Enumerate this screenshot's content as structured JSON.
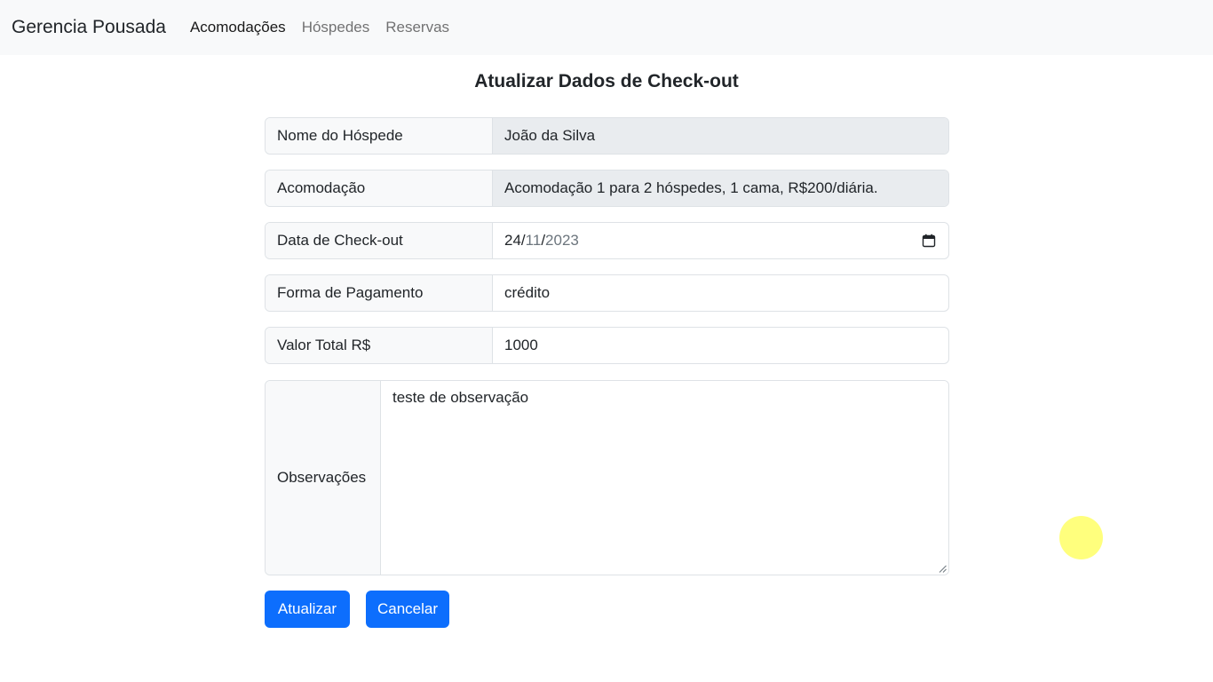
{
  "navbar": {
    "brand": "Gerencia Pousada",
    "links": [
      {
        "label": "Acomodações",
        "active": true
      },
      {
        "label": "Hóspedes",
        "active": false
      },
      {
        "label": "Reservas",
        "active": false
      }
    ]
  },
  "form": {
    "title": "Atualizar Dados de Check-out",
    "guest": {
      "label": "Nome do Hóspede",
      "value": "João da Silva"
    },
    "accommodation": {
      "label": "Acomodação",
      "value": "Acomodação 1 para 2 hóspedes, 1 cama, R$200/diária."
    },
    "checkout_date": {
      "label": "Data de Check-out",
      "day": "24",
      "month": "11",
      "year": "2023"
    },
    "payment": {
      "label": "Forma de Pagamento",
      "value": "crédito"
    },
    "total": {
      "label": "Valor Total R$",
      "value": "1000"
    },
    "notes": {
      "label": "Observações",
      "value": "teste de observação"
    }
  },
  "buttons": {
    "update_label": "Atualizar",
    "cancel_label": "Cancelar"
  },
  "colors": {
    "primary": "#0d6efd",
    "navbar_bg": "#f8f9fa",
    "readonly_bg": "#e9ecef",
    "cursor_highlight": "#ffff66"
  },
  "icons": {
    "date_picker": "calendar-icon"
  }
}
